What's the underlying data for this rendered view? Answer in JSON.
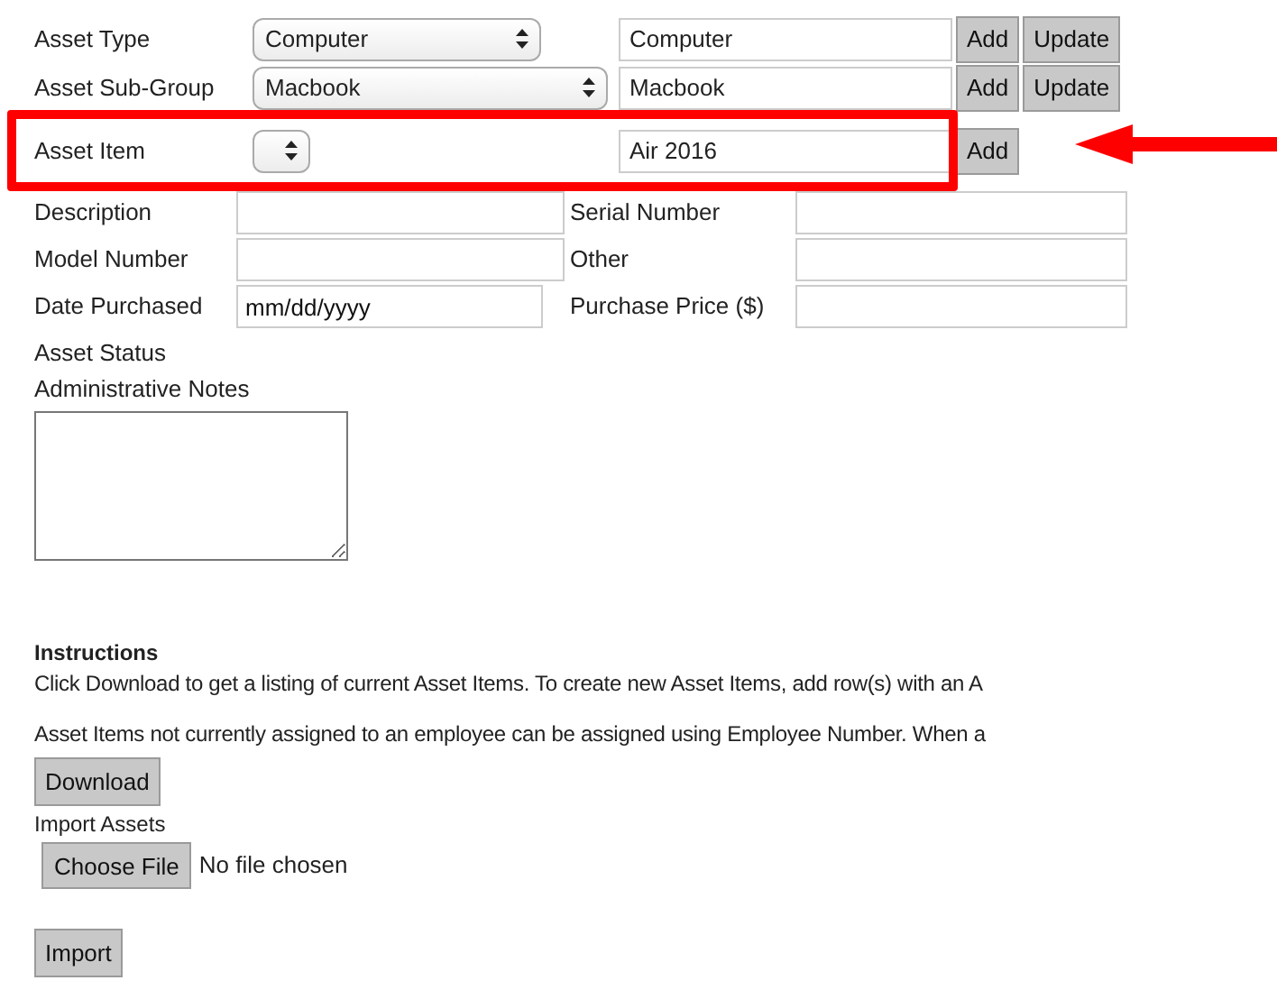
{
  "lookup_rows": [
    {
      "label": "Asset Type",
      "select": {
        "value": "Computer"
      },
      "text": "Computer",
      "buttons": [
        "Add",
        "Update"
      ],
      "highlighted": false
    },
    {
      "label": "Asset Sub-Group",
      "select": {
        "value": "Macbook"
      },
      "text": "Macbook",
      "buttons": [
        "Add",
        "Update"
      ],
      "highlighted": false
    },
    {
      "label": "Asset Item",
      "select": {},
      "text": "Air 2016",
      "buttons": [
        "Add"
      ],
      "highlighted": true
    }
  ],
  "detail_rows": [
    {
      "label": "Description",
      "field": {},
      "label_2": "Serial Number",
      "field_2": {}
    },
    {
      "label": "Model Number",
      "field": {},
      "label_2": "Other",
      "field_2": {}
    },
    {
      "label": "Date Purchased",
      "field": {
        "placeholder": "mm/dd/yyyy"
      },
      "label_2": "Purchase Price ($)",
      "field_2": {}
    }
  ],
  "asset_status_label": "Asset Status",
  "notes_label": "Administrative Notes",
  "instructions": {
    "heading": "Instructions",
    "paragraphs": [
      "Click Download to get a listing of current Asset Items. To create new Asset Items, add row(s) with an A",
      "Asset Items not currently assigned to an employee can be assigned using Employee Number. When a"
    ]
  },
  "download_button": "Download",
  "import_label": "Import Assets",
  "file_picker": {
    "button": "Choose File",
    "status": "No file chosen"
  },
  "import_button": "Import",
  "annotations": [
    {
      "kind": "arrow"
    }
  ]
}
